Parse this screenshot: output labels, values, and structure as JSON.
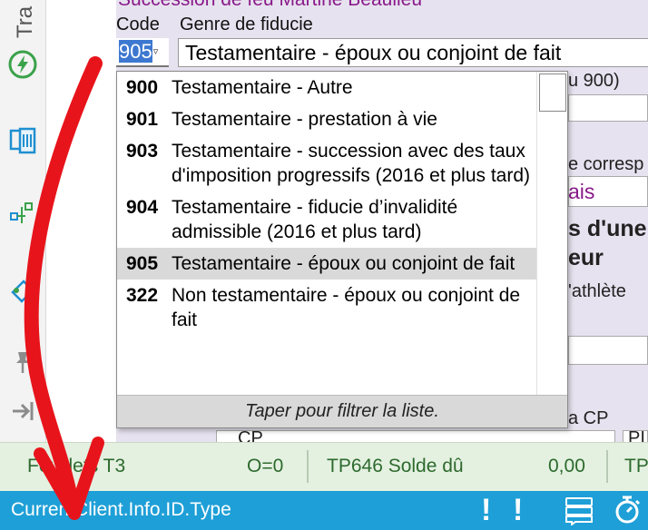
{
  "left_toolbar": {
    "tab_label": "Tra",
    "tools": [
      "lightning-icon",
      "copy-pages-icon",
      "tree-icon",
      "tag-icon",
      "pin-icon",
      "arrow-right-icon"
    ]
  },
  "form": {
    "client_title": "Succession de feu Martine Beaulieu",
    "code_label": "Code",
    "genre_label": "Genre de fiducie",
    "code_value": "905",
    "genre_value": "Testamentaire - époux ou conjoint de fait",
    "background_texts": {
      "u900": "u 900)",
      "corresp": "e corresp",
      "ais": "ais",
      "s_dune": "s d'une",
      "eur": "eur",
      "athlete": "'athlète",
      "a_cp": "a CP",
      "cp": "CP",
      "pi": "PI"
    }
  },
  "dropdown": {
    "items": [
      {
        "code": "900",
        "label": "Testamentaire - Autre",
        "selected": false
      },
      {
        "code": "901",
        "label": "Testamentaire - prestation à vie",
        "selected": false
      },
      {
        "code": "903",
        "label": "Testamentaire - succession avec des taux d'imposition progressifs (2016 et plus tard)",
        "selected": false
      },
      {
        "code": "904",
        "label": "Testamentaire - fiducie d’invalidité admissible (2016 et plus tard)",
        "selected": false
      },
      {
        "code": "905",
        "label": "Testamentaire - époux ou conjoint de fait",
        "selected": true
      },
      {
        "code": "322",
        "label": "Non testamentaire - époux ou conjoint de fait",
        "selected": false
      }
    ],
    "hint": "Taper pour filtrer la liste."
  },
  "summary": {
    "feuillets": "Feuillets T3",
    "o_count": "O=0",
    "tp646_label": "TP646 Solde dû",
    "tp646_value": "0,00",
    "tp_cut": "TP"
  },
  "status_bar": {
    "field_path": "CurrentClient.Info.ID.Type",
    "warning_1": "!",
    "warning_2": "!"
  },
  "colors": {
    "status_bar": "#1e9fd7",
    "summary_bg": "#e4f1e1",
    "summary_text": "#2d6a2d",
    "form_bg": "#e6e2ef",
    "client_title": "#8a1a8a",
    "selection": "#3c78d0",
    "annotation_arrow": "#e8141b"
  }
}
